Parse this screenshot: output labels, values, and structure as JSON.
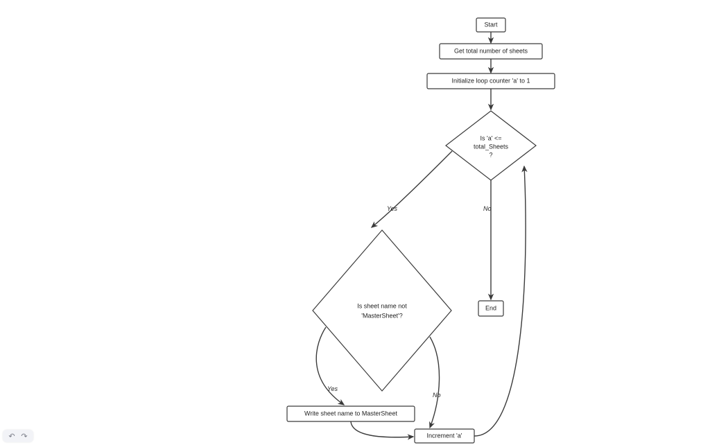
{
  "nodes": {
    "start": "Start",
    "get_total": "Get total number of sheets",
    "init": "Initialize loop counter 'a' to 1",
    "cond1_l1": "Is 'a' <=",
    "cond1_l2": "total_Sheets",
    "cond1_l3": "?",
    "cond2_l1": "Is sheet name not",
    "cond2_l2": "'MasterSheet'?",
    "write": "Write sheet name to MasterSheet",
    "increment": "Increment 'a'",
    "end": "End"
  },
  "edges": {
    "yes": "Yes",
    "no": "No"
  },
  "chart_data": {
    "type": "flowchart",
    "nodes": [
      {
        "id": "start",
        "kind": "terminator",
        "label": "Start"
      },
      {
        "id": "get_total",
        "kind": "process",
        "label": "Get total number of sheets"
      },
      {
        "id": "init",
        "kind": "process",
        "label": "Initialize loop counter 'a' to 1"
      },
      {
        "id": "cond1",
        "kind": "decision",
        "label": "Is 'a' <= total_Sheets ?"
      },
      {
        "id": "cond2",
        "kind": "decision",
        "label": "Is sheet name not 'MasterSheet'?"
      },
      {
        "id": "write",
        "kind": "process",
        "label": "Write sheet name to MasterSheet"
      },
      {
        "id": "increment",
        "kind": "process",
        "label": "Increment 'a'"
      },
      {
        "id": "end",
        "kind": "terminator",
        "label": "End"
      }
    ],
    "edges": [
      {
        "from": "start",
        "to": "get_total"
      },
      {
        "from": "get_total",
        "to": "init"
      },
      {
        "from": "init",
        "to": "cond1"
      },
      {
        "from": "cond1",
        "to": "cond2",
        "label": "Yes"
      },
      {
        "from": "cond1",
        "to": "end",
        "label": "No"
      },
      {
        "from": "cond2",
        "to": "write",
        "label": "Yes"
      },
      {
        "from": "cond2",
        "to": "increment",
        "label": "No"
      },
      {
        "from": "write",
        "to": "increment"
      },
      {
        "from": "increment",
        "to": "cond1"
      }
    ]
  }
}
